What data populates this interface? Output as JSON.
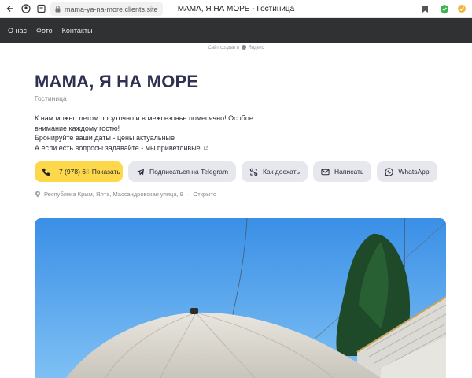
{
  "browser": {
    "url": "mama-ya-na-more.clients.site",
    "tab_title": "МАМА, Я НА МОРЕ - Гостиница"
  },
  "nav": {
    "items": [
      "О нас",
      "Фото",
      "Контакты"
    ]
  },
  "credit": {
    "text": "Сайт создан в",
    "brand": "Яндекс"
  },
  "business": {
    "title": "МАМА, Я НА МОРЕ",
    "category": "Гостиница",
    "description": [
      "К нам можно летом посуточно и в межсезонье помесячно! Особое",
      "внимание каждому гостю!",
      "Бронируйте ваши даты - цены актуальные",
      "А если есть вопросы задавайте - мы приветливые ☺"
    ]
  },
  "actions": {
    "phone_number": "+7 (978) 6",
    "phone_hidden": "8",
    "phone_show": "Показать",
    "telegram": "Подписаться на Telegram",
    "route": "Как доехать",
    "write": "Написать",
    "whatsapp": "WhatsApp"
  },
  "meta": {
    "address": "Республика Крым, Ялта, Массандровская улица, 9",
    "separator": "·",
    "status": "Открыто"
  },
  "colors": {
    "nav_bg": "#2f3133",
    "accent": "#fcd84a",
    "button_bg": "#e7e8ee",
    "title": "#2e3150"
  }
}
